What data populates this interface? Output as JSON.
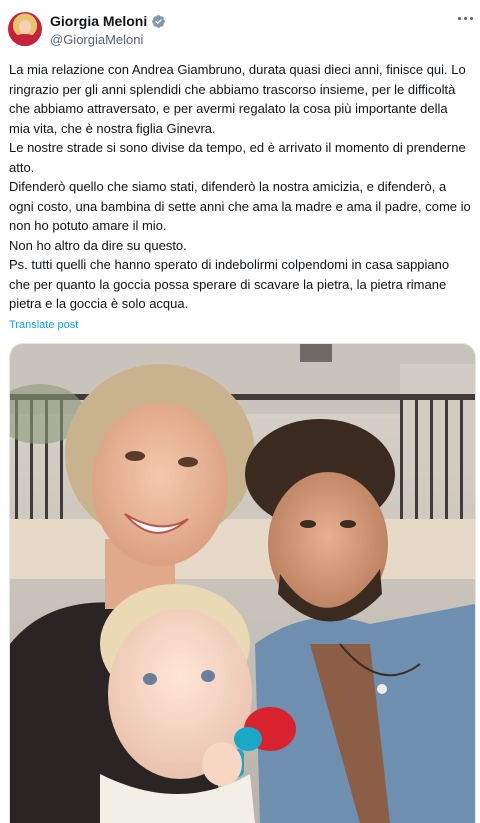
{
  "author": {
    "display_name": "Giorgia Meloni",
    "handle": "@GiorgiaMeloni",
    "verified": true,
    "avatar_icon": "profile-avatar"
  },
  "post": {
    "paragraphs": [
      "La mia relazione con Andrea Giambruno, durata quasi dieci anni, finisce qui. Lo ringrazio per gli anni splendidi che abbiamo trascorso insieme, per le difficoltà che abbiamo attraversato, e per avermi regalato la cosa più importante della mia vita, che è nostra figlia Ginevra.",
      "Le nostre strade si sono divise da tempo, ed è arrivato il momento di prenderne atto.",
      "Difenderò quello che siamo stati, difenderò la nostra amicizia, e difenderò, a ogni costo, una bambina di sette anni che ama la madre e ama il padre, come io non ho potuto amare il mio.",
      "Non ho altro da dire su questo.",
      "Ps. tutti quelli che hanno sperato di indebolirmi colpendomi in casa sappiano che per quanto la goccia possa sperare di scavare la pietra, la pietra rimane pietra e la goccia è solo acqua."
    ],
    "translate_label": "Translate post"
  },
  "icons": {
    "more": "more-horizontal-icon",
    "verified": "verified-badge-icon"
  },
  "colors": {
    "accent": "#1d9bf0",
    "text": "#0f1419",
    "secondary": "#536471"
  }
}
